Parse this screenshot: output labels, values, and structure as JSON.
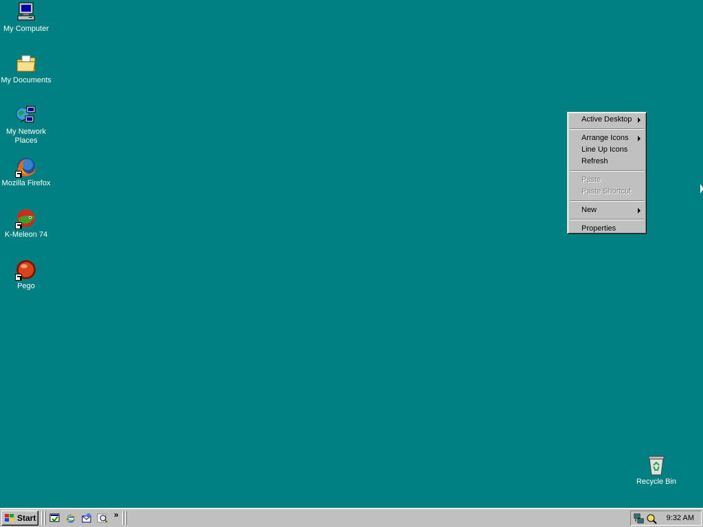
{
  "desktop": {
    "background_color": "#008080",
    "icons": [
      {
        "label": "My Computer",
        "icon": "computer-icon",
        "shortcut": false
      },
      {
        "label": "My Documents",
        "icon": "folder-icon",
        "shortcut": false
      },
      {
        "label_line1": "My Network",
        "label_line2": "Places",
        "icon": "network-icon",
        "shortcut": false
      },
      {
        "label": "Mozilla Firefox",
        "icon": "firefox-icon",
        "shortcut": true
      },
      {
        "label": "K-Meleon 74",
        "icon": "kmeleon-icon",
        "shortcut": true
      },
      {
        "label": "Pego",
        "icon": "pego-icon",
        "shortcut": true
      },
      {
        "label": "Recycle Bin",
        "icon": "recycle-bin-icon",
        "shortcut": false
      }
    ]
  },
  "context_menu": {
    "items": [
      {
        "label": "Active Desktop",
        "submenu": true,
        "enabled": true
      },
      {
        "label": "Arrange Icons",
        "submenu": true,
        "enabled": true
      },
      {
        "label": "Line Up Icons",
        "submenu": false,
        "enabled": true
      },
      {
        "label": "Refresh",
        "submenu": false,
        "enabled": true
      },
      {
        "label": "Paste",
        "submenu": false,
        "enabled": false
      },
      {
        "label": "Paste Shortcut",
        "submenu": false,
        "enabled": false
      },
      {
        "label": "New",
        "submenu": true,
        "enabled": true
      },
      {
        "label": "Properties",
        "submenu": false,
        "enabled": true
      }
    ]
  },
  "taskbar": {
    "start_label": "Start",
    "quick_launch": [
      "show-desktop-icon",
      "internet-explorer-icon",
      "outlook-express-icon",
      "search-icon"
    ],
    "tray_icons": [
      "network-tray-icon",
      "search-tray-icon"
    ],
    "clock": "9:32 AM"
  }
}
